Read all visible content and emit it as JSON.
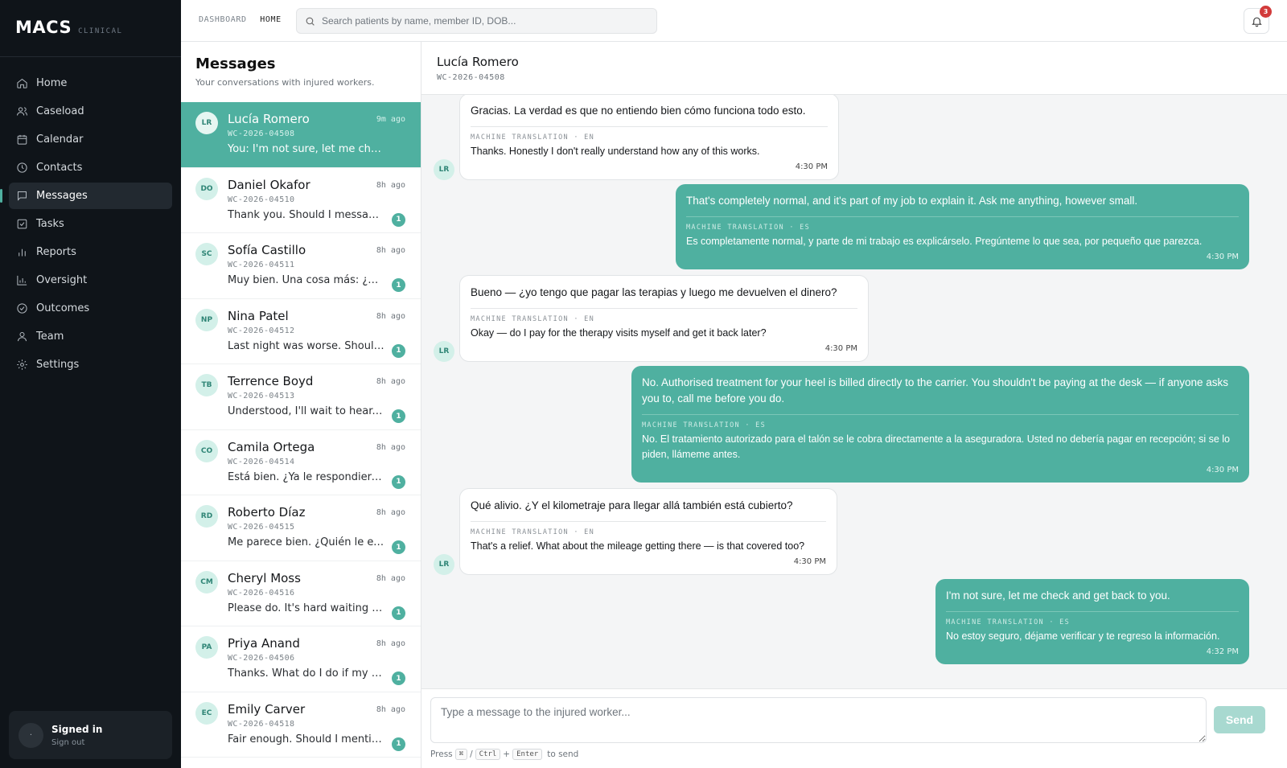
{
  "brand": {
    "name": "MACS",
    "sub": "CLINICAL"
  },
  "nav": [
    {
      "label": "Home",
      "icon": "home-icon",
      "active": false
    },
    {
      "label": "Caseload",
      "icon": "users-icon",
      "active": false
    },
    {
      "label": "Calendar",
      "icon": "calendar-icon",
      "active": false
    },
    {
      "label": "Contacts",
      "icon": "clock-icon",
      "active": false
    },
    {
      "label": "Messages",
      "icon": "message-icon",
      "active": true
    },
    {
      "label": "Tasks",
      "icon": "check-square-icon",
      "active": false
    },
    {
      "label": "Reports",
      "icon": "bar-chart-icon",
      "active": false
    },
    {
      "label": "Oversight",
      "icon": "chart-icon",
      "active": false
    },
    {
      "label": "Outcomes",
      "icon": "check-circle-icon",
      "active": false
    },
    {
      "label": "Team",
      "icon": "user-icon",
      "active": false
    },
    {
      "label": "Settings",
      "icon": "gear-icon",
      "active": false
    }
  ],
  "account": {
    "avatar": "·",
    "title": "Signed in",
    "signout": "Sign out"
  },
  "topbar": {
    "crumb_parent": "DASHBOARD",
    "crumb_current": "HOME",
    "search_placeholder": "Search patients by name, member ID, DOB...",
    "notif_count": "3"
  },
  "conversations_panel": {
    "title": "Messages",
    "subtitle": "Your conversations with injured workers."
  },
  "conversations": [
    {
      "initials": "LR",
      "name": "Lucía Romero",
      "id": "WC-2026-04508",
      "time": "9m ago",
      "preview": "You: I'm not sure, let me check and get back to you.",
      "unread": "",
      "active": true
    },
    {
      "initials": "DO",
      "name": "Daniel Okafor",
      "id": "WC-2026-04510",
      "time": "8h ago",
      "preview": "Thank you. Should I message you again later?",
      "unread": "1",
      "active": false
    },
    {
      "initials": "SC",
      "name": "Sofía Castillo",
      "id": "WC-2026-04511",
      "time": "8h ago",
      "preview": "Muy bien. Una cosa más: ¿me pueden ayudar?",
      "unread": "1",
      "active": false
    },
    {
      "initials": "NP",
      "name": "Nina Patel",
      "id": "WC-2026-04512",
      "time": "8h ago",
      "preview": "Last night was worse. Should I call someone?",
      "unread": "1",
      "active": false
    },
    {
      "initials": "TB",
      "name": "Terrence Boyd",
      "id": "WC-2026-04513",
      "time": "8h ago",
      "preview": "Understood, I'll wait to hear. I appreciate it.",
      "unread": "1",
      "active": false
    },
    {
      "initials": "CO",
      "name": "Camila Ortega",
      "id": "WC-2026-04514",
      "time": "8h ago",
      "preview": "Está bien. ¿Ya le respondieron del seguro?",
      "unread": "1",
      "active": false
    },
    {
      "initials": "RD",
      "name": "Roberto Díaz",
      "id": "WC-2026-04515",
      "time": "8h ago",
      "preview": "Me parece bien. ¿Quién le explica al doctor?",
      "unread": "1",
      "active": false
    },
    {
      "initials": "CM",
      "name": "Cheryl Moss",
      "id": "WC-2026-04516",
      "time": "8h ago",
      "preview": "Please do. It's hard waiting without news.",
      "unread": "1",
      "active": false
    },
    {
      "initials": "PA",
      "name": "Priya Anand",
      "id": "WC-2026-04506",
      "time": "8h ago",
      "preview": "Thanks. What do I do if my back gets worse?",
      "unread": "1",
      "active": false
    },
    {
      "initials": "EC",
      "name": "Emily Carver",
      "id": "WC-2026-04518",
      "time": "8h ago",
      "preview": "Fair enough. Should I mention it to my boss?",
      "unread": "1",
      "active": false
    }
  ],
  "chat": {
    "name": "Lucía Romero",
    "id": "WC-2026-04508",
    "avatar": "LR",
    "messages": [
      {
        "dir": "in",
        "text": "Gracias. La verdad es que no entiendo bien cómo funciona todo esto.",
        "mt_label": "MACHINE TRANSLATION · EN",
        "translation": "Thanks. Honestly I don't really understand how any of this works.",
        "time": "4:30 PM"
      },
      {
        "dir": "out",
        "text": "That's completely normal, and it's part of my job to explain it. Ask me anything, however small.",
        "mt_label": "MACHINE TRANSLATION · ES",
        "translation": "Es completamente normal, y parte de mi trabajo es explicárselo. Pregúnteme lo que sea, por pequeño que parezca.",
        "time": "4:30 PM"
      },
      {
        "dir": "in",
        "text": "Bueno — ¿yo tengo que pagar las terapias y luego me devuelven el dinero?",
        "mt_label": "MACHINE TRANSLATION · EN",
        "translation": "Okay — do I pay for the therapy visits myself and get it back later?",
        "time": "4:30 PM"
      },
      {
        "dir": "out",
        "text": "No. Authorised treatment for your heel is billed directly to the carrier. You shouldn't be paying at the desk — if anyone asks you to, call me before you do.",
        "mt_label": "MACHINE TRANSLATION · ES",
        "translation": "No. El tratamiento autorizado para el talón se le cobra directamente a la aseguradora. Usted no debería pagar en recepción; si se lo piden, llámeme antes.",
        "time": "4:30 PM"
      },
      {
        "dir": "in",
        "text": "Qué alivio. ¿Y el kilometraje para llegar allá también está cubierto?",
        "mt_label": "MACHINE TRANSLATION · EN",
        "translation": "That's a relief. What about the mileage getting there — is that covered too?",
        "time": "4:30 PM"
      },
      {
        "dir": "out",
        "text": "I'm not sure, let me check and get back to you.",
        "mt_label": "MACHINE TRANSLATION · ES",
        "translation": "No estoy seguro, déjame verificar y te regreso la información.",
        "time": "4:32 PM"
      }
    ]
  },
  "composer": {
    "placeholder": "Type a message to the injured worker...",
    "send_label": "Send",
    "hint_press": "Press",
    "hint_key1": "⌘",
    "hint_sep": "/",
    "hint_key2": "Ctrl",
    "hint_plus": "+",
    "hint_key3": "Enter",
    "hint_end": "to send"
  },
  "colors": {
    "accent": "#4fb0a0",
    "sidebar_bg": "#0f1419",
    "badge": "#d23b3b"
  }
}
